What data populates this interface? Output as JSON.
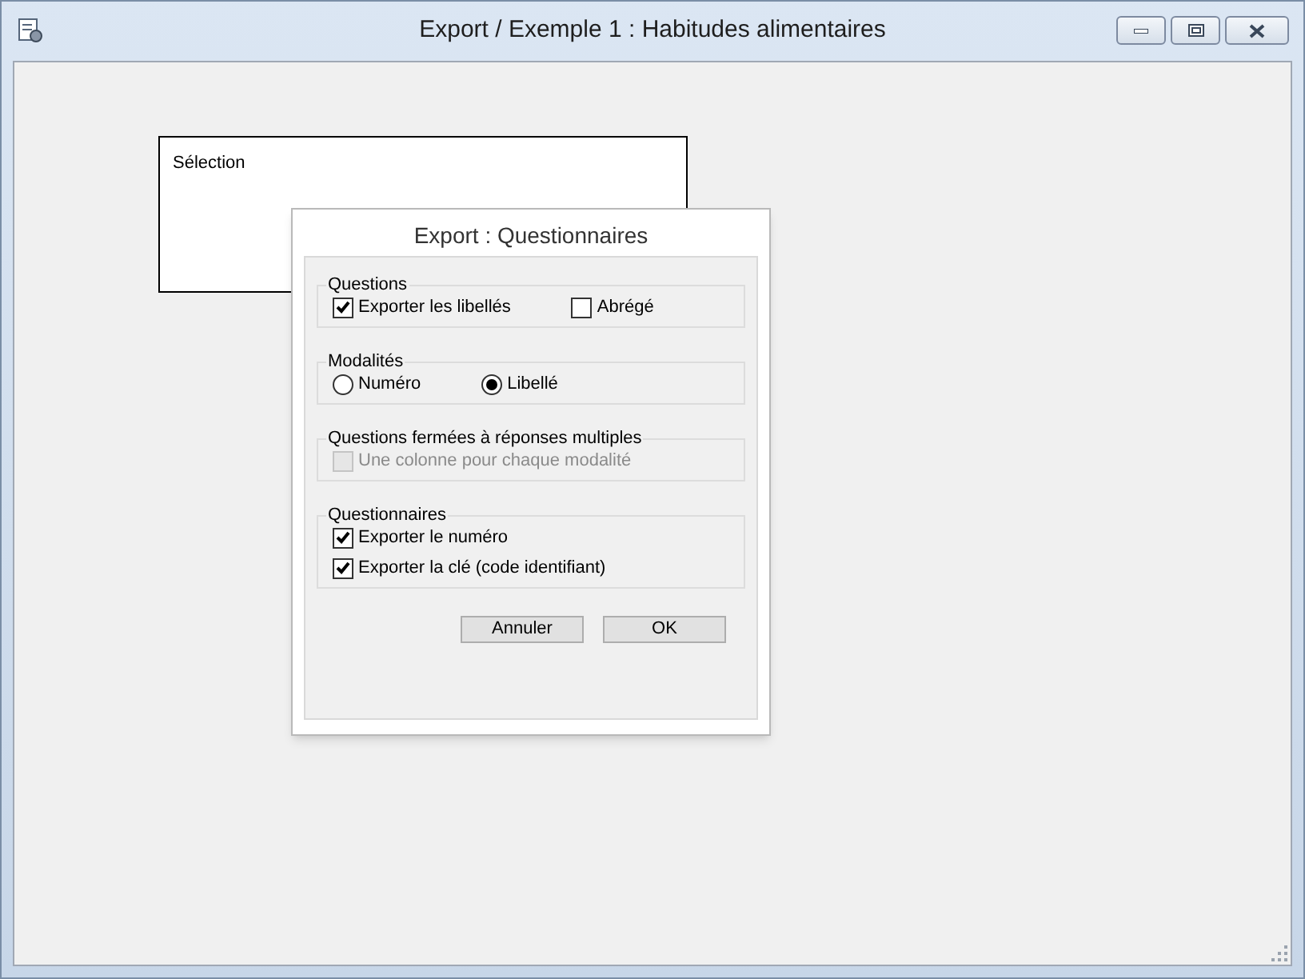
{
  "window": {
    "title": "Export / Exemple 1 : Habitudes alimentaires"
  },
  "selection_panel": {
    "label": "Sélection"
  },
  "dialog": {
    "title": "Export : Questionnaires",
    "groups": [
      {
        "title": "Questions",
        "items": [
          {
            "kind": "checkbox",
            "label": "Exporter les libellés",
            "checked": true,
            "disabled": false
          },
          {
            "kind": "checkbox",
            "label": "Abrégé",
            "checked": false,
            "disabled": false
          }
        ]
      },
      {
        "title": "Modalités",
        "items": [
          {
            "kind": "radio",
            "label": "Numéro",
            "selected": false
          },
          {
            "kind": "radio",
            "label": "Libellé",
            "selected": true
          }
        ]
      },
      {
        "title": "Questions fermées à réponses multiples",
        "items": [
          {
            "kind": "checkbox",
            "label": "Une colonne pour chaque modalité",
            "checked": false,
            "disabled": true
          }
        ]
      },
      {
        "title": "Questionnaires",
        "items": [
          {
            "kind": "checkbox",
            "label": "Exporter le numéro",
            "checked": true,
            "disabled": false
          },
          {
            "kind": "checkbox",
            "label": "Exporter la clé (code identifiant)",
            "checked": true,
            "disabled": false
          }
        ]
      }
    ],
    "buttons": [
      "Annuler",
      "OK"
    ]
  }
}
